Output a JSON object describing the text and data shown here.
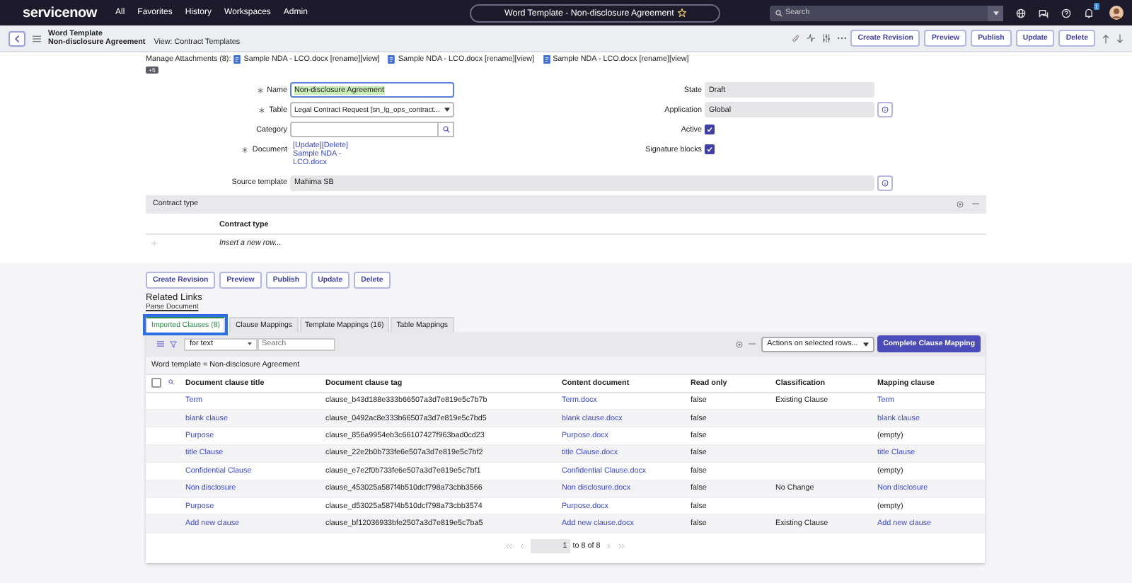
{
  "top_nav": {
    "logo": "servicenow",
    "menu": [
      "All",
      "Favorites",
      "History",
      "Workspaces",
      "Admin"
    ],
    "title": "Word Template - Non-disclosure Agreement",
    "search_placeholder": "Search",
    "notification_count": "1"
  },
  "header": {
    "record_type": "Word Template",
    "record_name": "Non-disclosure Agreement",
    "view": "View: Contract Templates",
    "buttons": [
      "Create Revision",
      "Preview",
      "Publish",
      "Update",
      "Delete"
    ]
  },
  "attachments": {
    "label": "Manage Attachments (8):",
    "files": [
      {
        "name": "Sample NDA - LCO.docx",
        "actions": "[rename][view]"
      },
      {
        "name": "Sample NDA - LCO.docx",
        "actions": "[rename][view]"
      },
      {
        "name": "Sample NDA - LCO.docx",
        "actions": "[rename][view]"
      }
    ],
    "more": "+5"
  },
  "form": {
    "left": [
      {
        "label": "Name",
        "required": true,
        "kind": "text",
        "value": "Non-disclosure Agreement"
      },
      {
        "label": "Table",
        "required": true,
        "kind": "select",
        "value": "Legal Contract Request [sn_lg_ops_contract..."
      },
      {
        "label": "Category",
        "required": false,
        "kind": "lookup"
      },
      {
        "label": "Document",
        "required": true,
        "kind": "links",
        "links": [
          "[Update]",
          "[Delete]"
        ],
        "value": "Sample NDA - LCO.docx"
      }
    ],
    "right": [
      {
        "label": "State",
        "kind": "readonly",
        "value": "Draft"
      },
      {
        "label": "Application",
        "kind": "readonly_info",
        "value": "Global"
      },
      {
        "label": "Active",
        "kind": "checkbox",
        "checked": true
      },
      {
        "label": "Signature blocks",
        "kind": "checkbox",
        "checked": true
      }
    ],
    "source_template": {
      "label": "Source template",
      "value": "Mahima SB"
    }
  },
  "contract_type": {
    "title": "Contract type",
    "column": "Contract type",
    "insert": "Insert a new row..."
  },
  "buttons": [
    "Create Revision",
    "Preview",
    "Publish",
    "Update",
    "Delete"
  ],
  "related_links": {
    "title": "Related Links",
    "links": [
      "Parse Document"
    ]
  },
  "tabs": [
    {
      "label": "Imported Clauses (8)",
      "selected": true
    },
    {
      "label": "Clause Mappings",
      "selected": false
    },
    {
      "label": "Template Mappings (16)",
      "selected": false
    },
    {
      "label": "Table Mappings",
      "selected": false
    }
  ],
  "list": {
    "filter_field": "for text",
    "search_placeholder": "Search",
    "actions": "Actions on selected rows...",
    "complete_button": "Complete Clause Mapping",
    "breadcrumb": "Word template = Non-disclosure Agreement",
    "select_all_checked": false,
    "columns": [
      "Document clause title",
      "Document clause tag",
      "Content document",
      "Read only",
      "Classification",
      "Mapping clause"
    ],
    "rows": [
      {
        "title": "Term",
        "tag": "clause_b43d188e333b66507a3d7e819e5c7b7b",
        "content": "Term.docx",
        "read_only": "false",
        "classification": "Existing Clause",
        "mapping": {
          "text": "Term",
          "link": true
        }
      },
      {
        "title": "blank clause",
        "tag": "clause_0492ac8e333b66507a3d7e819e5c7bd5",
        "content": "blank clause.docx",
        "read_only": "false",
        "classification": "",
        "mapping": {
          "text": "blank clause",
          "link": true
        }
      },
      {
        "title": "Purpose",
        "tag": "clause_856a9954eb3c66107427f963bad0cd23",
        "content": "Purpose.docx",
        "read_only": "false",
        "classification": "",
        "mapping": {
          "text": "(empty)",
          "link": false
        }
      },
      {
        "title": "title Clause",
        "tag": "clause_22e2b0b733fe6e507a3d7e819e5c7bf2",
        "content": "title Clause.docx",
        "read_only": "false",
        "classification": "",
        "mapping": {
          "text": "title Clause",
          "link": true
        }
      },
      {
        "title": "Confidential Clause",
        "tag": "clause_e7e2f0b733fe6e507a3d7e819e5c7bf1",
        "content": "Confidential Clause.docx",
        "read_only": "false",
        "classification": "",
        "mapping": {
          "text": "(empty)",
          "link": false
        }
      },
      {
        "title": "Non disclosure",
        "tag": "clause_453025a587f4b510dcf798a73cbb3566",
        "content": "Non disclosure.docx",
        "read_only": "false",
        "classification": "No Change",
        "mapping": {
          "text": "Non disclosure",
          "link": true
        }
      },
      {
        "title": "Purpose",
        "tag": "clause_d53025a587f4b510dcf798a73cbb3574",
        "content": "Purpose.docx",
        "read_only": "false",
        "classification": "",
        "mapping": {
          "text": "(empty)",
          "link": false
        }
      },
      {
        "title": "Add new clause",
        "tag": "clause_bf12036933bfe2507a3d7e819e5c7ba5",
        "content": "Add new clause.docx",
        "read_only": "false",
        "classification": "Existing Clause",
        "mapping": {
          "text": "Add new clause",
          "link": true
        }
      }
    ],
    "pagination": {
      "page": "1",
      "range": "to 8 of 8"
    }
  }
}
